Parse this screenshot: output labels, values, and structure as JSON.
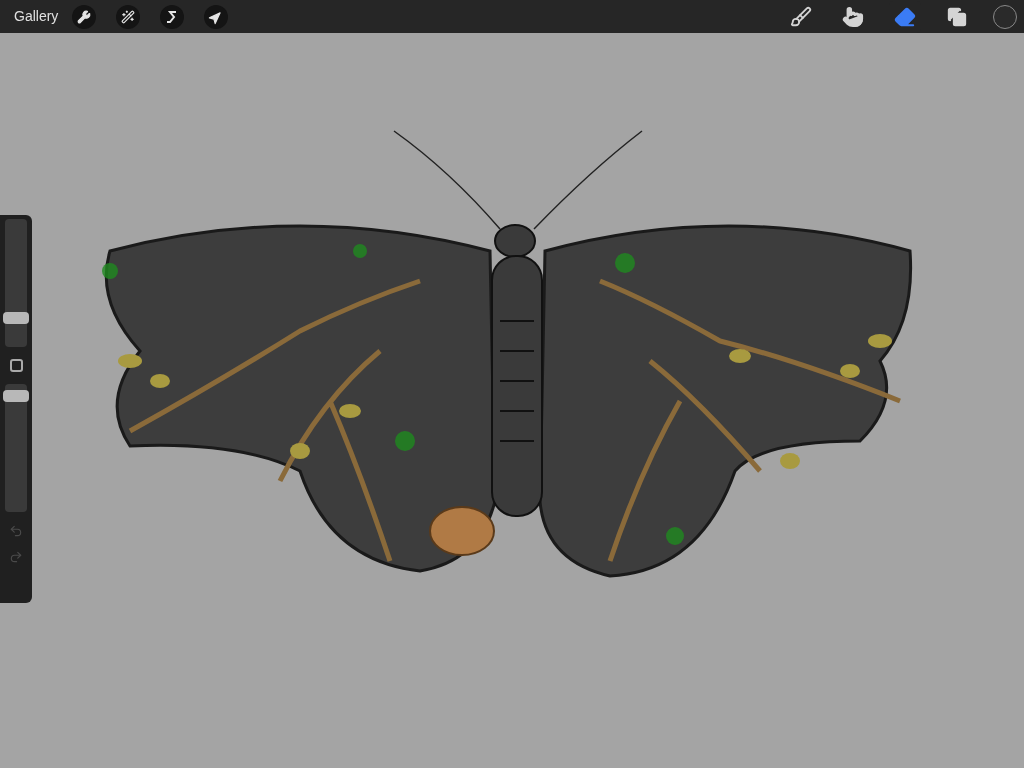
{
  "toolbar": {
    "gallery_label": "Gallery",
    "left_tools": [
      {
        "kind": "actions"
      },
      {
        "kind": "adjustments"
      },
      {
        "kind": "selection"
      },
      {
        "kind": "transform"
      }
    ],
    "right_tools": [
      {
        "kind": "brush",
        "selected": false
      },
      {
        "kind": "smudge",
        "selected": false
      },
      {
        "kind": "eraser",
        "selected": true
      },
      {
        "kind": "layers",
        "selected": false
      }
    ],
    "color_swatch": {
      "color": "#2a2a2a"
    }
  },
  "sidebar": {
    "size_slider": {
      "level": 0.2
    },
    "opacity_slider": {
      "level": 0.95
    },
    "undo": {
      "disabled": true
    },
    "redo": {
      "disabled": true
    }
  }
}
